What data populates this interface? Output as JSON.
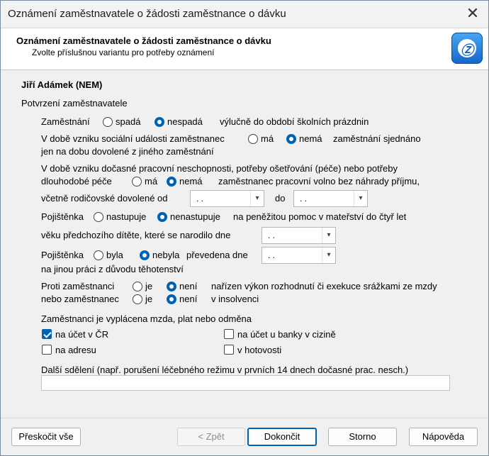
{
  "window": {
    "title": "Oznámení zaměstnavatele o žádosti zaměstnance o dávku"
  },
  "header": {
    "title": "Oznámení zaměstnavatele o žádosti zaměstnance o dávku",
    "subtitle": "Zvolte příslušnou variantu pro potřeby oznámení"
  },
  "employee_name": "Jiří Adámek (NEM)",
  "section_title": "Potvrzení zaměstnavatele",
  "rows": {
    "employment": {
      "label": "Zaměstnání",
      "opt1": "spadá",
      "opt2": "nespadá",
      "selected": "nespadá",
      "suffix": "výlučně do období školních prázdnin"
    },
    "other_employer": {
      "label": "V době vzniku sociální události zaměstnanec",
      "opt1": "má",
      "opt2": "nemá",
      "selected": "nemá",
      "suffix": "zaměstnání sjednáno",
      "line2": "jen na dobu dovolené z jiného zaměstnání"
    },
    "leave": {
      "line1": "V době vzniku dočasné pracovní neschopnosti, potřeby ošetřování (péče) nebo potřeby",
      "label": "dlouhodobé péče",
      "opt1": "má",
      "opt2": "nemá",
      "selected": "nemá",
      "suffix": "zaměstnanec pracovní volno bez náhrady příjmu,",
      "line3": "včetně rodičovské dovolené od",
      "from_value": ". .",
      "to_label": "do",
      "to_value": ". ."
    },
    "maternity": {
      "label": "Pojištěnka",
      "opt1": "nastupuje",
      "opt2": "nenastupuje",
      "selected": "nenastupuje",
      "suffix": "na peněžitou pomoc v mateřství do čtyř let",
      "line2": "věku předchozího dítěte, které se narodilo dne",
      "date_value": ". ."
    },
    "transfer": {
      "label": "Pojištěnka",
      "opt1": "byla",
      "opt2": "nebyla",
      "selected": "nebyla",
      "suffix": "převedena dne",
      "date_value": ". .",
      "line2": "na jinou práci z důvodu těhotenství"
    },
    "execution": {
      "label1": "Proti zaměstnanci",
      "opt1": "je",
      "opt2": "není",
      "selected1": "není",
      "suffix1": "nařízen výkon rozhodnutí či exekuce srážkami ze mzdy",
      "label2": "nebo zaměstnanec",
      "selected2": "není",
      "suffix2": "v insolvenci"
    }
  },
  "payment": {
    "title": "Zaměstnanci je vyplácena mzda, plat nebo odměna",
    "options": [
      {
        "label": "na účet v ČR",
        "checked": true
      },
      {
        "label": "na účet u banky v cizině",
        "checked": false
      },
      {
        "label": "na adresu",
        "checked": false
      },
      {
        "label": "v hotovosti",
        "checked": false
      }
    ]
  },
  "notes": {
    "label": "Další sdělení (např. porušení léčebného režimu v prvních 14 dnech dočasné prac. nesch.)",
    "value": ""
  },
  "buttons": {
    "skip": "Přeskočit vše",
    "back": "< Zpět",
    "finish": "Dokončit",
    "cancel": "Storno",
    "help": "Nápověda"
  },
  "colors": {
    "accent": "#0063b1"
  }
}
